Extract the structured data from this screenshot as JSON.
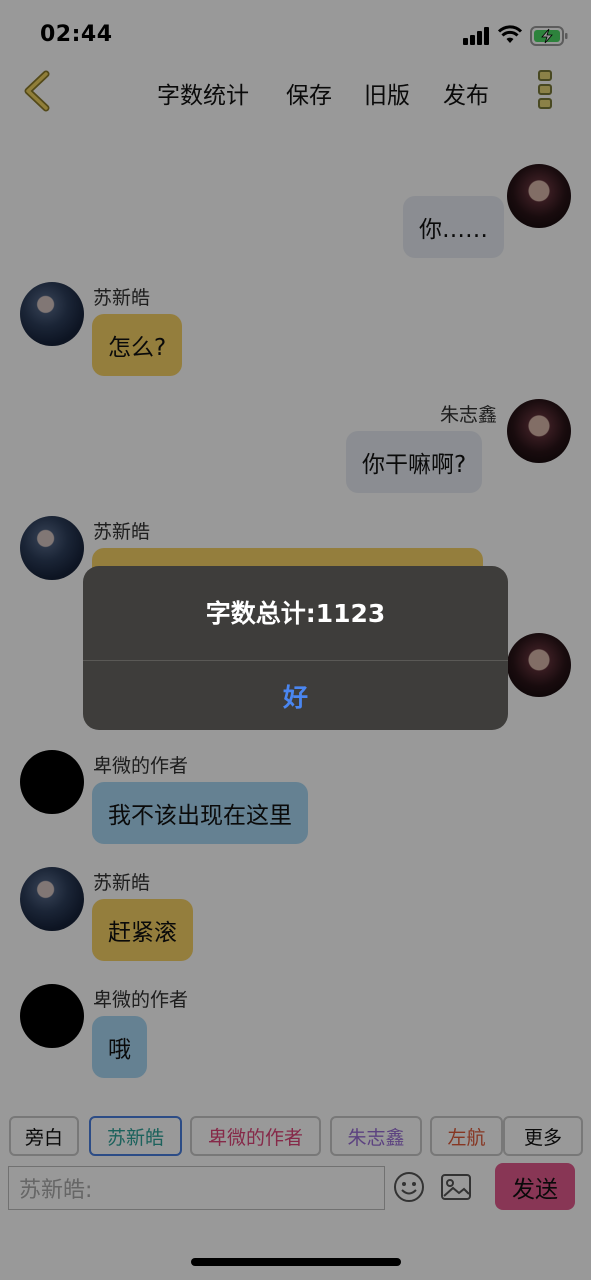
{
  "status_bar": {
    "time": "02:44"
  },
  "nav": {
    "links": [
      "字数统计",
      "保存",
      "旧版",
      "发布"
    ]
  },
  "messages": [
    {
      "side": "right",
      "sender": "",
      "text": "你……",
      "color": "gray"
    },
    {
      "side": "left",
      "sender": "苏新皓",
      "text": "怎么?",
      "color": "yellow"
    },
    {
      "side": "right",
      "sender": "朱志鑫",
      "text": "你干嘛啊?",
      "color": "gray"
    },
    {
      "side": "left",
      "sender": "苏新皓",
      "text": "",
      "color": "yellow"
    },
    {
      "side": "left",
      "sender": "卑微的作者",
      "text": "我不该出现在这里",
      "color": "blue"
    },
    {
      "side": "left",
      "sender": "苏新皓",
      "text": "赶紧滚",
      "color": "yellow"
    },
    {
      "side": "left",
      "sender": "卑微的作者",
      "text": "哦",
      "color": "blue"
    }
  ],
  "alert": {
    "title": "字数总计:1123",
    "button": "好"
  },
  "roles": [
    {
      "label": "旁白",
      "color": "#111111",
      "selected": false
    },
    {
      "label": "苏新皓",
      "color": "#2fa39a",
      "selected": true
    },
    {
      "label": "卑微的作者",
      "color": "#e0457a",
      "selected": false
    },
    {
      "label": "朱志鑫",
      "color": "#9a6fd6",
      "selected": false
    },
    {
      "label": "左航",
      "color": "#e05a3a",
      "selected": false
    },
    {
      "label": "更多",
      "color": "#111111",
      "selected": false
    }
  ],
  "composer": {
    "placeholder": "苏新皓:",
    "send_label": "发送",
    "emoji_icon": "emoji-icon",
    "image_icon": "image-icon"
  }
}
